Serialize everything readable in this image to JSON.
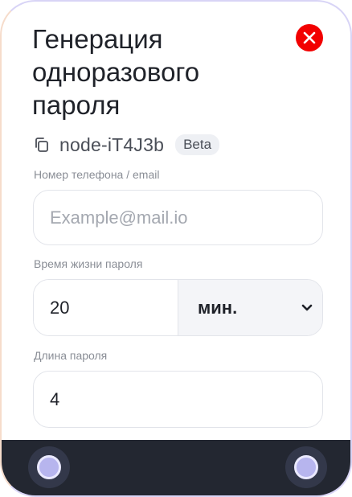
{
  "dialog": {
    "title": "Генерация одноразового пароля"
  },
  "node": {
    "id": "node-iT4J3b",
    "badge": "Beta"
  },
  "fields": {
    "contact": {
      "label": "Номер телефона / email",
      "placeholder": "Example@mail.io",
      "value": ""
    },
    "lifetime": {
      "label": "Время жизни пароля",
      "value": "20",
      "unit": "мин."
    },
    "length": {
      "label": "Длина пароля",
      "value": "4"
    }
  },
  "icons": {
    "close": "close-icon",
    "copy": "copy-icon",
    "dropdown": "chevron-down-icon",
    "orb": "orb-icon"
  },
  "colors": {
    "close_button": "#f20000",
    "bottom_bar": "#232731",
    "orb": "#b7b5ee"
  }
}
